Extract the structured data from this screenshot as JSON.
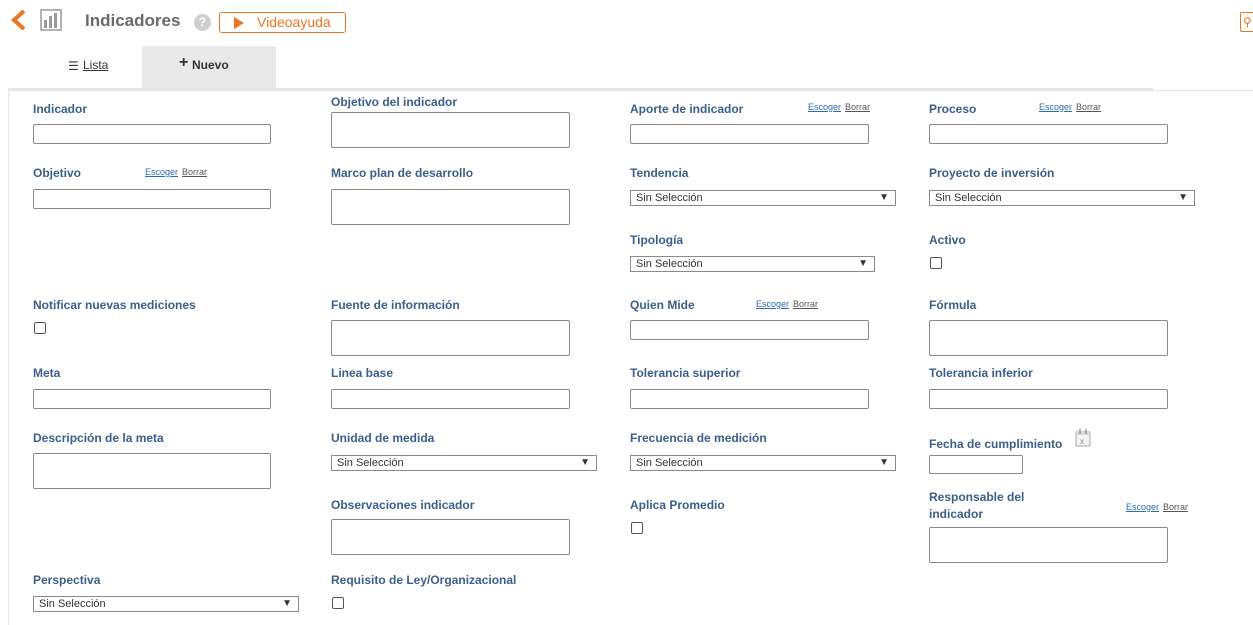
{
  "header": {
    "title": "Indicadores",
    "help_symbol": "?",
    "video_button_label": "Videoayuda",
    "key_symbol": "🔍"
  },
  "tabs": [
    {
      "label": "Lista",
      "icon": "list-icon"
    },
    {
      "label": "Nuevo",
      "icon": "plus-icon"
    }
  ],
  "links": {
    "choose": "Escoger",
    "clear": "Borrar"
  },
  "form": {
    "indicador": {
      "label": "Indicador",
      "value": ""
    },
    "objetivo_indicador": {
      "label": "Objetivo del indicador",
      "value": ""
    },
    "aporte_indicador": {
      "label": "Aporte de indicador",
      "value": ""
    },
    "proceso": {
      "label": "Proceso",
      "value": ""
    },
    "objetivo": {
      "label": "Objetivo",
      "value": ""
    },
    "marco_plan": {
      "label": "Marco plan de desarrollo",
      "value": ""
    },
    "tendencia": {
      "label": "Tendencia",
      "selected": "Sin Selección"
    },
    "proyecto_inversion": {
      "label": "Proyecto de inversión",
      "selected": "Sin Selección"
    },
    "tipologia": {
      "label": "Tipología",
      "selected": "Sin Selección"
    },
    "activo": {
      "label": "Activo",
      "checked": false
    },
    "notificar": {
      "label": "Notificar nuevas mediciones",
      "checked": false
    },
    "fuente": {
      "label": "Fuente de información",
      "value": ""
    },
    "quien_mide": {
      "label": "Quien Mide",
      "value": ""
    },
    "formula": {
      "label": "Fórmula",
      "value": ""
    },
    "meta": {
      "label": "Meta",
      "value": ""
    },
    "linea_base": {
      "label": "Linea base",
      "value": ""
    },
    "tol_superior": {
      "label": "Tolerancia superior",
      "value": ""
    },
    "tol_inferior": {
      "label": "Tolerancia inferior",
      "value": ""
    },
    "desc_meta": {
      "label": "Descripción de la meta",
      "value": ""
    },
    "unidad_medida": {
      "label": "Unidad de medida",
      "selected": "Sin Selección"
    },
    "frecuencia": {
      "label": "Frecuencia de medición",
      "selected": "Sin Selección"
    },
    "fecha_cumplimiento": {
      "label": "Fecha de cumplimiento",
      "value": ""
    },
    "observaciones": {
      "label": "Observaciones indicador",
      "value": ""
    },
    "aplica_promedio": {
      "label": "Aplica Promedio",
      "checked": false
    },
    "responsable": {
      "label": "Responsable del indicador",
      "value": ""
    },
    "perspectiva": {
      "label": "Perspectiva",
      "selected": "Sin Selección"
    },
    "requisito_ley": {
      "label": "Requisito de Ley/Organizacional",
      "checked": false
    }
  },
  "colors": {
    "accent": "#e87722",
    "label": "#3a5f8a",
    "tab_active_bg": "#e9e9e9"
  }
}
